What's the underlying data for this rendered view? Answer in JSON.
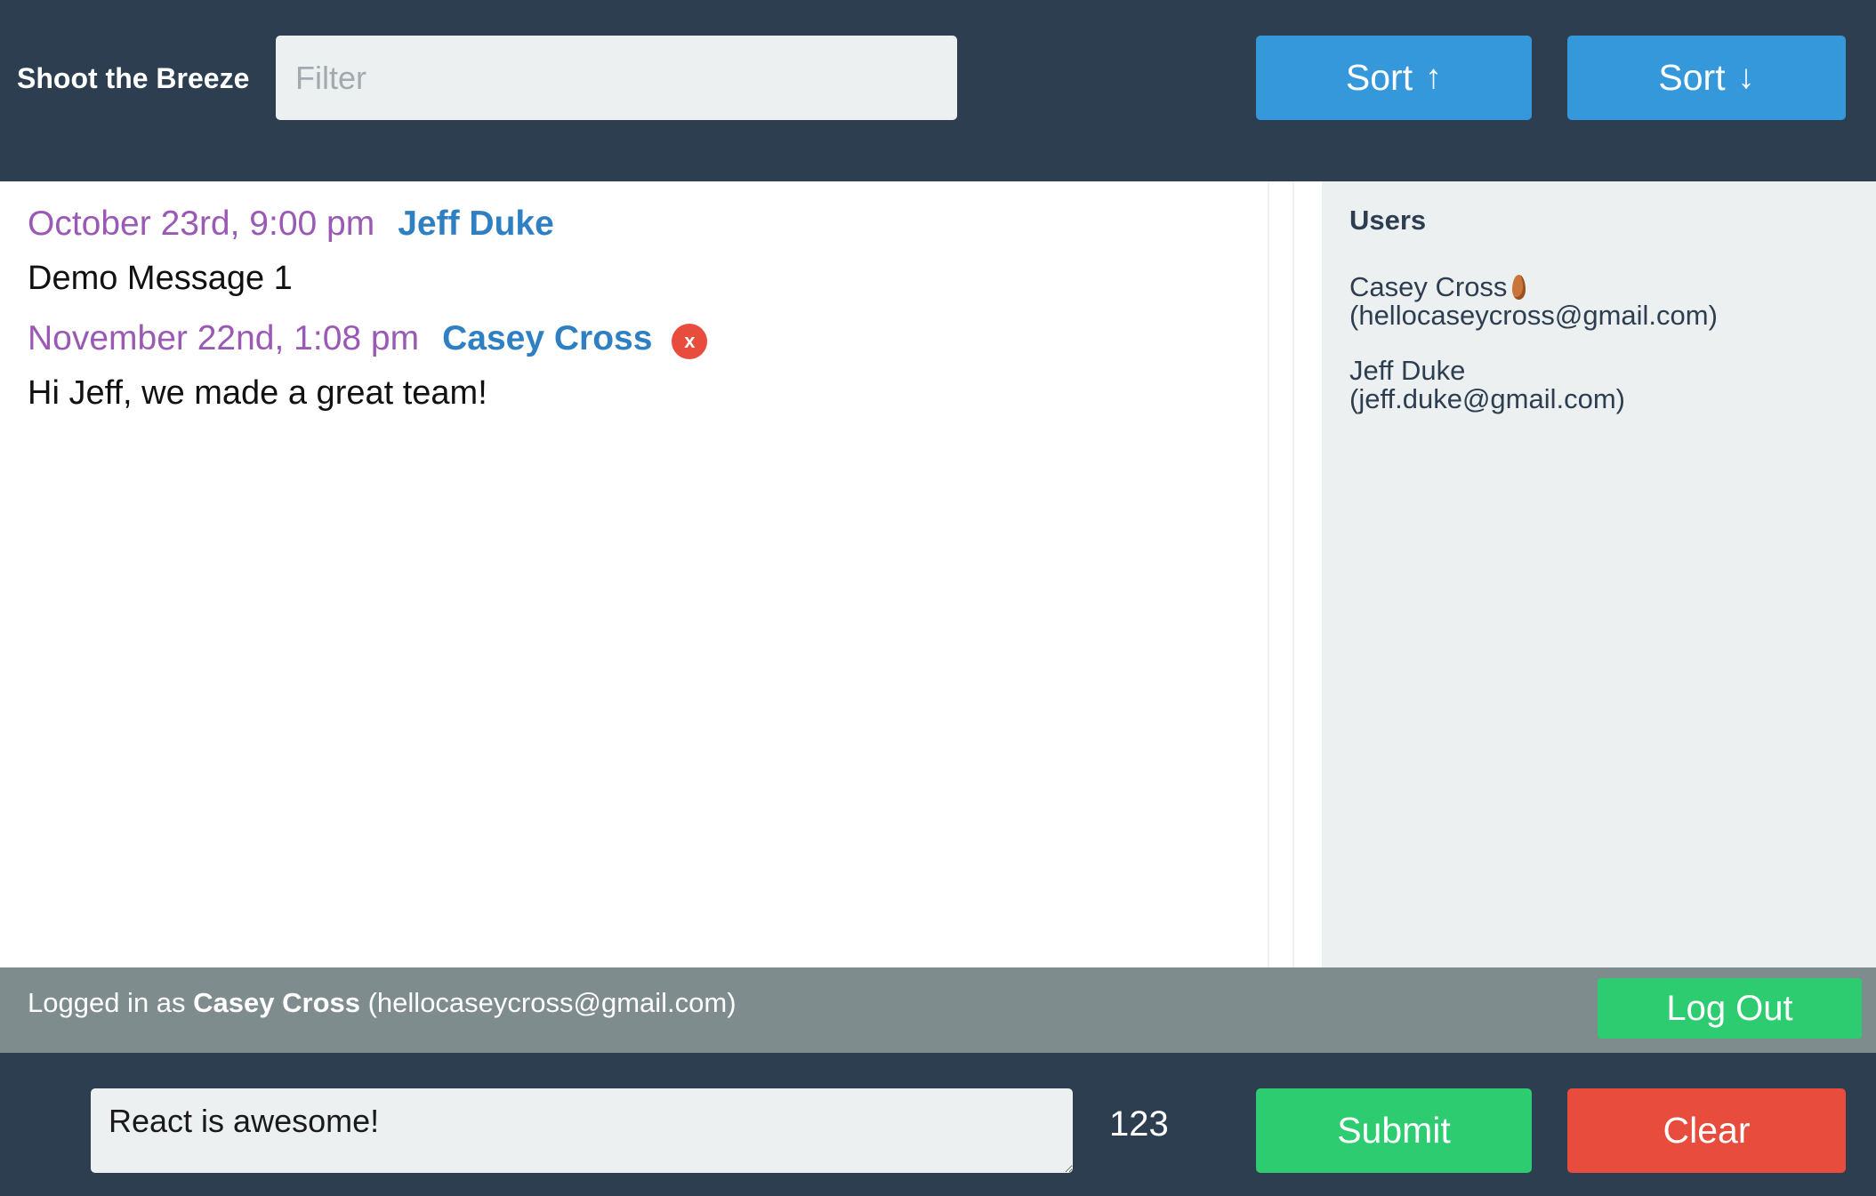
{
  "app": {
    "title": "Shoot the Breeze"
  },
  "header": {
    "filter_placeholder": "Filter",
    "filter_value": "",
    "sort_asc_label": "Sort",
    "sort_asc_icon": "arrow-up-icon",
    "sort_asc_glyph": "↑",
    "sort_desc_label": "Sort",
    "sort_desc_icon": "arrow-down-icon",
    "sort_desc_glyph": "↓"
  },
  "messages": [
    {
      "time": "October 23rd, 9:00 pm",
      "author": "Jeff Duke",
      "text": "Demo Message 1",
      "deletable": false
    },
    {
      "time": "November 22nd, 1:08 pm",
      "author": "Casey Cross",
      "text": "Hi Jeff, we made a great team!",
      "deletable": true,
      "delete_label": "x"
    }
  ],
  "users": {
    "title": "Users",
    "list": [
      {
        "name": "Casey Cross",
        "email": "(hellocaseycross@gmail.com)",
        "icon": "almond-icon"
      },
      {
        "name": "Jeff Duke",
        "email": "(jeff.duke@gmail.com)"
      }
    ]
  },
  "status": {
    "prefix": "Logged in as ",
    "user_name": "Casey Cross",
    "user_email": " (hellocaseycross@gmail.com)",
    "logout_label": "Log Out"
  },
  "composer": {
    "message_value": "React is awesome!",
    "char_count": "123",
    "submit_label": "Submit",
    "clear_label": "Clear"
  },
  "colors": {
    "header_bg": "#2d3e50",
    "accent_blue": "#3498db",
    "green": "#2ecc71",
    "red": "#e74c3c",
    "purple_time": "#9b59b6",
    "author_blue": "#2f80c2",
    "status_gray": "#7f8c8d"
  }
}
